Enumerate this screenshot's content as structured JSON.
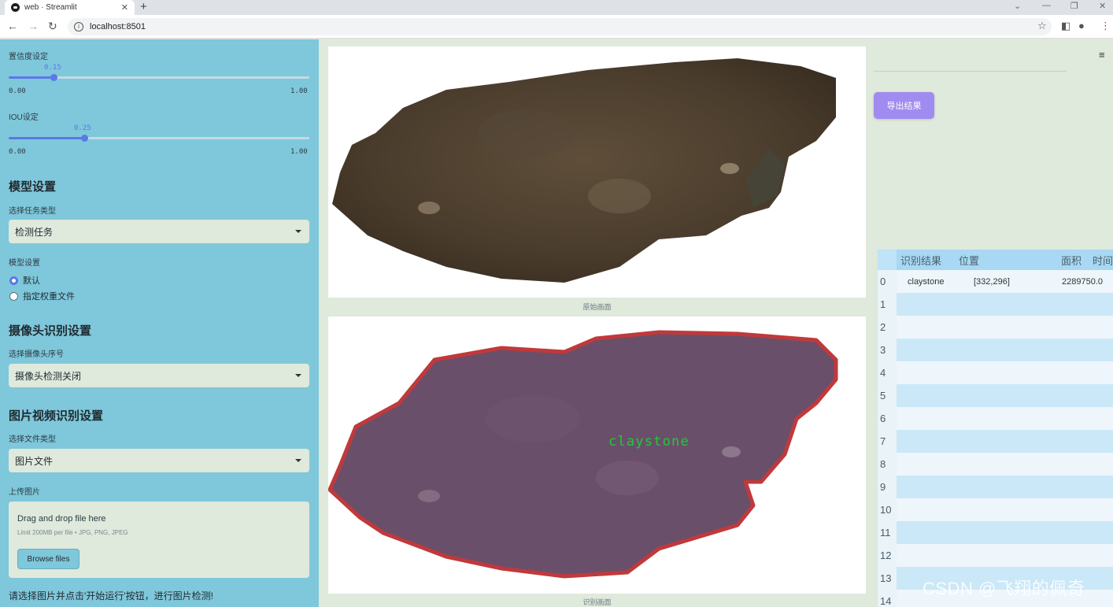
{
  "browser": {
    "tab_title": "web · Streamlit",
    "tab_close": "✕",
    "new_tab": "+",
    "url": "localhost:8501",
    "win_min": "—",
    "win_restore": "❐",
    "win_close": "✕"
  },
  "sidebar": {
    "conf_label": "置信度设定",
    "conf_value": "0.15",
    "conf_fraction": 0.15,
    "conf_min": "0.00",
    "conf_max": "1.00",
    "iou_label": "IOU设定",
    "iou_value": "0.25",
    "iou_fraction": 0.25,
    "iou_min": "0.00",
    "iou_max": "1.00",
    "model_header": "模型设置",
    "task_label": "选择任务类型",
    "task_value": "检测任务",
    "model_label": "模型设置",
    "radio_default": "默认",
    "radio_custom": "指定权重文件",
    "camera_header": "摄像头识别设置",
    "camera_label": "选择摄像头序号",
    "camera_value": "摄像头检测关闭",
    "media_header": "图片视频识别设置",
    "filetype_label": "选择文件类型",
    "filetype_value": "图片文件",
    "upload_label": "上传图片",
    "dropzone_title": "Drag and drop file here",
    "dropzone_limit": "Limit 200MB per file • JPG, PNG, JPEG",
    "browse_label": "Browse files",
    "hint": "请选择图片并点击'开始运行'按钮，进行图片检测!"
  },
  "main": {
    "original_caption": "原始画面",
    "result_caption": "识别画面",
    "detection_label": "claystone",
    "export_label": "导出结果",
    "colors": {
      "accent": "#5b78e8",
      "export": "#a08bf0",
      "sidebar": "#7fc7db",
      "mask": "#6a4f6b",
      "outline": "#c0393b",
      "label": "#22c83a"
    }
  },
  "table": {
    "headers": [
      "识别结果",
      "位置",
      "面积",
      "时间"
    ],
    "rows": [
      {
        "index": "0",
        "result": "claystone",
        "position": "[332,296]",
        "area": "2289750.0",
        "time": ""
      },
      {
        "index": "1"
      },
      {
        "index": "2"
      },
      {
        "index": "3"
      },
      {
        "index": "4"
      },
      {
        "index": "5"
      },
      {
        "index": "6"
      },
      {
        "index": "7"
      },
      {
        "index": "8"
      },
      {
        "index": "9"
      },
      {
        "index": "10"
      },
      {
        "index": "11"
      },
      {
        "index": "12"
      },
      {
        "index": "13"
      },
      {
        "index": "14"
      }
    ]
  },
  "watermark": "CSDN @飞翔的佩奇"
}
